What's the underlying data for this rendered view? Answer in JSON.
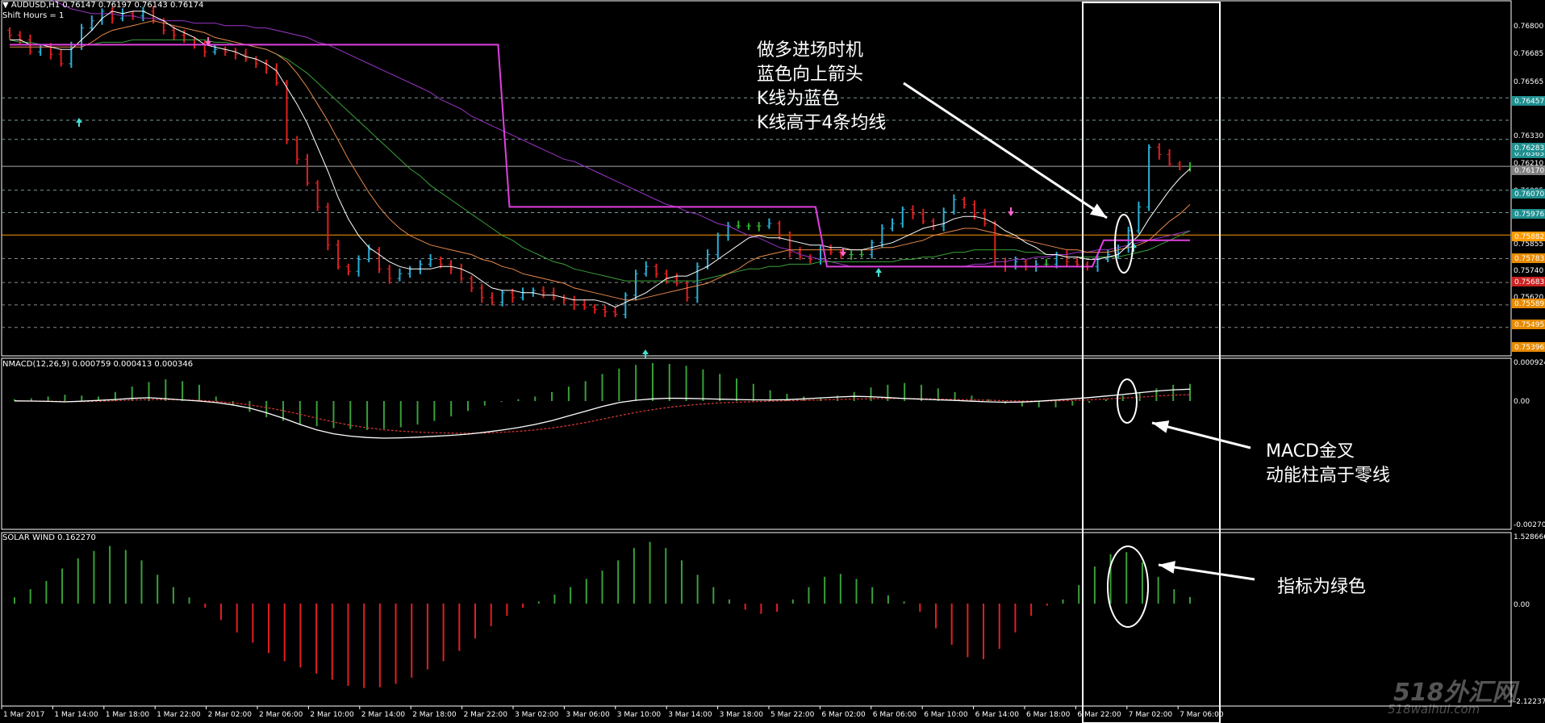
{
  "header": {
    "symbol": "AUDUSD,H1",
    "ohlc": "0.76147 0.76197 0.76143 0.76174",
    "shift": "Shift Hours = 1"
  },
  "macd": {
    "label": "NMACD(12,26,9) 0.000759 0.000413 0.000346",
    "scale": [
      "0.000924",
      "0.00",
      "-0.002707"
    ]
  },
  "solar": {
    "label": "SOLAR WIND 0.162270",
    "scale": [
      "1.528666",
      "0.00",
      "-2.122370"
    ]
  },
  "price_scale": {
    "labels": [
      "0.76800",
      "0.76685",
      "0.76565",
      "0.76330",
      "0.76210",
      "0.76095",
      "0.75855",
      "0.75740",
      "0.75620",
      "0.75505",
      "0.75396"
    ],
    "tags": [
      {
        "text": "0.76457",
        "color": "#1f8f8f"
      },
      {
        "text": "0.76363",
        "color": "#1f8f8f"
      },
      {
        "text": "0.76283",
        "color": "#1f8f8f"
      },
      {
        "text": "0.76170",
        "color": "#808080"
      },
      {
        "text": "0.76070",
        "color": "#1f8f8f"
      },
      {
        "text": "0.75976",
        "color": "#1f8f8f"
      },
      {
        "text": "0.75882",
        "color": "#ff9900"
      },
      {
        "text": "0.75783",
        "color": "#e68a00"
      },
      {
        "text": "0.75683",
        "color": "#cc2222"
      },
      {
        "text": "0.75589",
        "color": "#e68a00"
      },
      {
        "text": "0.75495",
        "color": "#e68a00"
      },
      {
        "text": "0.75396",
        "color": "#e68a00"
      }
    ]
  },
  "time_axis": [
    "1 Mar 2017",
    "1 Mar 14:00",
    "1 Mar 18:00",
    "1 Mar 22:00",
    "2 Mar 02:00",
    "2 Mar 06:00",
    "2 Mar 10:00",
    "2 Mar 14:00",
    "2 Mar 18:00",
    "2 Mar 22:00",
    "3 Mar 02:00",
    "3 Mar 06:00",
    "3 Mar 10:00",
    "3 Mar 14:00",
    "3 Mar 18:00",
    "5 Mar 22:00",
    "6 Mar 02:00",
    "6 Mar 06:00",
    "6 Mar 10:00",
    "6 Mar 14:00",
    "6 Mar 18:00",
    "6 Mar 22:00",
    "7 Mar 02:00",
    "7 Mar 06:00"
  ],
  "annotations": {
    "entry": [
      "做多进场时机",
      "蓝色向上箭头",
      "K线为蓝色",
      "K线高于4条均线"
    ],
    "macd": [
      "MACD金叉",
      "动能柱高于零线"
    ],
    "solar": [
      "指标为绿色"
    ]
  },
  "watermark": {
    "brand": "518外汇网",
    "url": "518waihui.com"
  },
  "colors": {
    "bull": "#2ab0d8",
    "bear": "#e02020",
    "neutral": "#30b030",
    "ma_white": "#ffffff",
    "ma_orange": "#e8894a",
    "ma_green": "#3aa03a",
    "ma_purple": "#9b35c8",
    "step": "#e040e0",
    "hist_pos": "#3aa03a",
    "hist_neg": "#e02020",
    "signal": "#cc3333",
    "grid": "#7a9a9a"
  },
  "chart_data": [
    {
      "type": "candlestick",
      "series": [
        {
          "name": "AUDUSD,H1"
        }
      ],
      "close": [
        0.7672,
        0.767,
        0.7665,
        0.7667,
        0.7664,
        0.766,
        0.7668,
        0.7675,
        0.7678,
        0.7682,
        0.7679,
        0.7681,
        0.768,
        0.7682,
        0.7678,
        0.7674,
        0.7672,
        0.767,
        0.7668,
        0.7665,
        0.7666,
        0.7665,
        0.7664,
        0.7662,
        0.766,
        0.7658,
        0.7652,
        0.7628,
        0.762,
        0.761,
        0.76,
        0.7584,
        0.7575,
        0.7573,
        0.7578,
        0.7582,
        0.7574,
        0.757,
        0.7572,
        0.7574,
        0.7576,
        0.7578,
        0.7576,
        0.7574,
        0.757,
        0.7566,
        0.7562,
        0.756,
        0.7564,
        0.7562,
        0.7564,
        0.7565,
        0.7564,
        0.7562,
        0.7561,
        0.7559,
        0.7558,
        0.7557,
        0.7556,
        0.7555,
        0.7563,
        0.7572,
        0.7575,
        0.7572,
        0.757,
        0.7568,
        0.7562,
        0.7575,
        0.758,
        0.7588,
        0.7592,
        0.7592,
        0.7592,
        0.7592,
        0.7593,
        0.7588,
        0.7581,
        0.7579,
        0.7578,
        0.7582,
        0.7581,
        0.758,
        0.758,
        0.758,
        0.7585,
        0.7591,
        0.7593,
        0.7599,
        0.7597,
        0.7594,
        0.7592,
        0.7598,
        0.7603,
        0.7601,
        0.7597,
        0.7593,
        0.7577,
        0.7575,
        0.7577,
        0.7575,
        0.7576,
        0.7576,
        0.758,
        0.7577,
        0.7576,
        0.7575,
        0.7578,
        0.758,
        0.7583,
        0.759,
        0.76,
        0.7625,
        0.7622,
        0.7618,
        0.7617,
        0.7617
      ],
      "ma_white": [
        0.767,
        0.767,
        0.7668,
        0.7668,
        0.7667,
        0.7666,
        0.7666,
        0.767,
        0.7674,
        0.7679,
        0.7682,
        0.7681,
        0.7682,
        0.7682,
        0.768,
        0.7678,
        0.7675,
        0.7673,
        0.7671,
        0.7668,
        0.7667,
        0.7666,
        0.7665,
        0.7663,
        0.7662,
        0.766,
        0.7657,
        0.765,
        0.7643,
        0.7635,
        0.7625,
        0.7615,
        0.7604,
        0.7595,
        0.7588,
        0.7583,
        0.758,
        0.7577,
        0.7575,
        0.7574,
        0.7574,
        0.7574,
        0.7575,
        0.7575,
        0.7574,
        0.7572,
        0.7569,
        0.7566,
        0.7565,
        0.7565,
        0.7564,
        0.7564,
        0.7563,
        0.7563,
        0.7562,
        0.7561,
        0.7561,
        0.7561,
        0.756,
        0.7558,
        0.756,
        0.7562,
        0.7564,
        0.7567,
        0.757,
        0.7571,
        0.7571,
        0.7573,
        0.7575,
        0.7578,
        0.7581,
        0.7584,
        0.7587,
        0.7588,
        0.7587,
        0.7587,
        0.7586,
        0.7585,
        0.7584,
        0.7584,
        0.7583,
        0.7583,
        0.7582,
        0.7582,
        0.7583,
        0.7584,
        0.7585,
        0.7587,
        0.7589,
        0.7591,
        0.7592,
        0.7593,
        0.7595,
        0.7596,
        0.7596,
        0.7595,
        0.7593,
        0.759,
        0.7588,
        0.7585,
        0.7583,
        0.758,
        0.758,
        0.7579,
        0.7579,
        0.7578,
        0.7578,
        0.7579,
        0.758,
        0.7584,
        0.7588,
        0.7595,
        0.7601,
        0.7607,
        0.7612,
        0.7616
      ],
      "ma_orange": [
        0.7667,
        0.7667,
        0.7667,
        0.7667,
        0.7667,
        0.7667,
        0.7667,
        0.7667,
        0.7669,
        0.7672,
        0.7674,
        0.7675,
        0.7676,
        0.7677,
        0.7678,
        0.7677,
        0.7676,
        0.7675,
        0.7674,
        0.7673,
        0.7671,
        0.767,
        0.7669,
        0.7668,
        0.7667,
        0.7666,
        0.7664,
        0.7661,
        0.7656,
        0.765,
        0.7643,
        0.7636,
        0.7628,
        0.762,
        0.7613,
        0.7606,
        0.76,
        0.7595,
        0.7591,
        0.7588,
        0.7586,
        0.7584,
        0.7583,
        0.7582,
        0.7581,
        0.758,
        0.7578,
        0.7577,
        0.7575,
        0.7574,
        0.7572,
        0.7571,
        0.757,
        0.7569,
        0.7568,
        0.7566,
        0.7565,
        0.7564,
        0.7563,
        0.7562,
        0.7561,
        0.7561,
        0.7562,
        0.7563,
        0.7564,
        0.7565,
        0.7566,
        0.7567,
        0.7568,
        0.757,
        0.7572,
        0.7574,
        0.7577,
        0.7579,
        0.758,
        0.7581,
        0.7582,
        0.7582,
        0.7582,
        0.7582,
        0.7582,
        0.7582,
        0.7582,
        0.7582,
        0.7582,
        0.7583,
        0.7583,
        0.7584,
        0.7585,
        0.7586,
        0.7588,
        0.7589,
        0.759,
        0.7591,
        0.7591,
        0.759,
        0.7589,
        0.7588,
        0.7587,
        0.7586,
        0.7585,
        0.7584,
        0.7583,
        0.7582,
        0.7582,
        0.7581,
        0.7581,
        0.7581,
        0.7582,
        0.7583,
        0.7584,
        0.7586,
        0.759,
        0.7594,
        0.7597,
        0.7601
      ],
      "ma_green": [
        0.767,
        0.7669,
        0.7669,
        0.7668,
        0.7668,
        0.7668,
        0.7668,
        0.7668,
        0.7668,
        0.7669,
        0.7669,
        0.7669,
        0.767,
        0.767,
        0.767,
        0.767,
        0.767,
        0.767,
        0.767,
        0.767,
        0.7669,
        0.7669,
        0.7668,
        0.7668,
        0.7667,
        0.7666,
        0.7664,
        0.7662,
        0.7659,
        0.7656,
        0.7652,
        0.7648,
        0.7644,
        0.764,
        0.7636,
        0.7632,
        0.7628,
        0.7624,
        0.762,
        0.7616,
        0.7613,
        0.7609,
        0.7606,
        0.7603,
        0.76,
        0.7597,
        0.7594,
        0.7591,
        0.7588,
        0.7586,
        0.7583,
        0.7581,
        0.7579,
        0.7577,
        0.7576,
        0.7574,
        0.7573,
        0.7572,
        0.7571,
        0.757,
        0.7569,
        0.7569,
        0.7569,
        0.7569,
        0.7569,
        0.7569,
        0.7569,
        0.7569,
        0.757,
        0.7571,
        0.7572,
        0.7573,
        0.7574,
        0.7574,
        0.7575,
        0.7575,
        0.7576,
        0.7576,
        0.7576,
        0.7577,
        0.7577,
        0.7577,
        0.7577,
        0.7577,
        0.7577,
        0.7577,
        0.7577,
        0.7578,
        0.7578,
        0.7579,
        0.7579,
        0.758,
        0.7581,
        0.7581,
        0.7582,
        0.7582,
        0.7582,
        0.7582,
        0.7582,
        0.7581,
        0.7581,
        0.758,
        0.758,
        0.7579,
        0.7579,
        0.7579,
        0.7579,
        0.7579,
        0.7579,
        0.758,
        0.7581,
        0.7582,
        0.7584,
        0.7586,
        0.7588,
        0.759
      ],
      "ma_purple": [
        0.7698,
        0.7695,
        0.7692,
        0.769,
        0.7687,
        0.7685,
        0.7683,
        0.7682,
        0.7681,
        0.7681,
        0.7681,
        0.768,
        0.768,
        0.7679,
        0.7679,
        0.7678,
        0.7678,
        0.7678,
        0.7677,
        0.7677,
        0.7677,
        0.7676,
        0.7676,
        0.7676,
        0.7675,
        0.7675,
        0.7674,
        0.7673,
        0.7672,
        0.7671,
        0.7669,
        0.7668,
        0.7666,
        0.7664,
        0.7662,
        0.766,
        0.7658,
        0.7656,
        0.7654,
        0.7652,
        0.765,
        0.7648,
        0.7645,
        0.7643,
        0.7641,
        0.7638,
        0.7636,
        0.7634,
        0.7632,
        0.763,
        0.7628,
        0.7626,
        0.7624,
        0.7622,
        0.762,
        0.7619,
        0.7617,
        0.7615,
        0.7613,
        0.7611,
        0.7609,
        0.7607,
        0.7605,
        0.7603,
        0.7601,
        0.76,
        0.7598,
        0.7597,
        0.7595,
        0.7593,
        0.7592,
        0.759,
        0.7588,
        0.7587,
        0.7585,
        0.7583,
        0.7582,
        0.758,
        0.7579,
        0.7578,
        0.7577,
        0.7576,
        0.7575,
        0.7575,
        0.7575,
        0.7575,
        0.7575,
        0.7575,
        0.7575,
        0.7575,
        0.7575,
        0.7575,
        0.7575,
        0.7575,
        0.7576,
        0.7576,
        0.7577,
        0.7577,
        0.7578,
        0.7578,
        0.7579,
        0.7579,
        0.758,
        0.758,
        0.7581,
        0.7581,
        0.7582,
        0.7582,
        0.7583,
        0.7584,
        0.7585,
        0.7586,
        0.7587,
        0.7588,
        0.7589,
        0.759
      ],
      "step_levels": [
        {
          "from": 0,
          "to": 60,
          "value": 0.7668
        },
        {
          "from": 61,
          "to": 99,
          "value": 0.76
        },
        {
          "from": 100,
          "to": 133,
          "value": 0.7575
        },
        {
          "from": 134,
          "to": 145,
          "value": 0.7586
        }
      ],
      "horizontal_lines": [
        0.76457,
        0.76363,
        0.76283,
        0.7617,
        0.7607,
        0.75976,
        0.75882,
        0.75783,
        0.75683,
        0.75589,
        0.75495
      ]
    },
    {
      "type": "bar",
      "title": "NMACD(12,26,9) 0.000759 0.000413 0.000346",
      "ylim": [
        -0.002707,
        0.000924
      ],
      "series": [
        {
          "name": "histogram",
          "values": [
            2e-05,
            3e-05,
            5e-05,
            7e-05,
            6e-05,
            5e-05,
            0.0001,
            0.00016,
            0.00021,
            0.00024,
            0.00022,
            0.00018,
            5e-05,
            -5e-05,
            -0.00012,
            -0.00018,
            -0.00022,
            -0.00026,
            -0.00028,
            -0.0003,
            -0.00031,
            -0.00032,
            -0.00031,
            -0.00029,
            -0.00026,
            -0.00022,
            -0.00017,
            -0.00011,
            -5e-05,
            -1e-05,
            2e-05,
            5e-05,
            0.0001,
            0.00016,
            0.00022,
            0.0003,
            0.00036,
            0.0004,
            0.00042,
            0.00041,
            0.00039,
            0.00035,
            0.0003,
            0.00025,
            0.00019,
            0.00012,
            8e-05,
            5e-05,
            4e-05,
            6e-05,
            0.0001,
            0.00015,
            0.00018,
            0.0002,
            0.00018,
            0.00014,
            0.0001,
            6e-05,
            2e-05,
            -3e-05,
            -6e-05,
            -7e-05,
            -7e-05,
            -5e-05,
            -2e-05,
            2e-05,
            6e-05,
            0.0001,
            0.00014,
            0.00018,
            0.00019
          ]
        },
        {
          "name": "NMACD",
          "values": [
            1e-05,
            0.0,
            -2e-05,
            -5e-05,
            -1e-05,
            4e-05,
            0.0001,
            0.00017,
            0.00021,
            0.00015,
            7e-05,
            0.0,
            -0.0001,
            -0.00025,
            -0.00045,
            -0.00075,
            -0.0011,
            -0.0015,
            -0.00185,
            -0.0021,
            -0.00225,
            -0.00234,
            -0.00238,
            -0.00236,
            -0.00232,
            -0.00226,
            -0.0022,
            -0.00212,
            -0.002,
            -0.00186,
            -0.0017,
            -0.0015,
            -0.00125,
            -0.00095,
            -0.00065,
            -0.00035,
            -0.0001,
            5e-05,
            0.00014,
            0.00018,
            0.00017,
            0.00015,
            0.00012,
            0.0001,
            8e-05,
            7e-05,
            9e-05,
            0.00014,
            0.0002,
            0.00026,
            0.0003,
            0.00028,
            0.00022,
            0.00016,
            0.00012,
            8e-05,
            4e-05,
            -1e-05,
            -5e-05,
            -8e-05,
            -6e-05,
            -1e-05,
            6e-05,
            0.00014,
            0.00022,
            0.00032,
            0.00042,
            0.00054,
            0.00064,
            0.00072,
            0.00076
          ]
        },
        {
          "name": "Signal",
          "values": [
            0.0,
            0.0,
            -1e-05,
            -3e-05,
            -3e-05,
            -1e-05,
            2e-05,
            6e-05,
            9e-05,
            0.0001,
            8e-05,
            4e-05,
            -3e-05,
            -0.00012,
            -0.00025,
            -0.00042,
            -0.00062,
            -0.00085,
            -0.0011,
            -0.00134,
            -0.00155,
            -0.00172,
            -0.00184,
            -0.00193,
            -0.00199,
            -0.00203,
            -0.00206,
            -0.00207,
            -0.00205,
            -0.002,
            -0.00194,
            -0.00185,
            -0.00173,
            -0.00157,
            -0.00138,
            -0.00116,
            -0.00094,
            -0.00073,
            -0.00055,
            -0.0004,
            -0.00028,
            -0.00019,
            -0.00012,
            -8e-05,
            -4e-05,
            -1e-05,
            2e-05,
            4e-05,
            7e-05,
            0.0001,
            0.00013,
            0.00015,
            0.00016,
            0.00016,
            0.00015,
            0.00013,
            0.0001,
            8e-05,
            5e-05,
            2e-05,
            0.0,
            0.0,
            1e-05,
            4e-05,
            8e-05,
            0.00013,
            0.00019,
            0.00025,
            0.00032,
            0.00038,
            0.00041
          ]
        }
      ]
    },
    {
      "type": "bar",
      "title": "SOLAR WIND 0.162270",
      "ylim": [
        -2.12237,
        1.528666
      ],
      "series": [
        {
          "name": "SOLAR WIND",
          "values": [
            0.15,
            0.35,
            0.55,
            0.85,
            1.1,
            1.28,
            1.4,
            1.3,
            1.05,
            0.7,
            0.4,
            0.15,
            -0.1,
            -0.4,
            -0.7,
            -0.95,
            -1.2,
            -1.4,
            -1.55,
            -1.7,
            -1.85,
            -2.0,
            -2.05,
            -2.03,
            -1.95,
            -1.8,
            -1.6,
            -1.4,
            -1.15,
            -0.85,
            -0.55,
            -0.3,
            -0.1,
            0.05,
            0.22,
            0.4,
            0.6,
            0.8,
            1.05,
            1.35,
            1.5,
            1.35,
            1.05,
            0.7,
            0.4,
            0.1,
            -0.15,
            -0.25,
            -0.2,
            0.1,
            0.4,
            0.65,
            0.72,
            0.6,
            0.4,
            0.2,
            0.05,
            -0.2,
            -0.6,
            -1.0,
            -1.3,
            -1.35,
            -1.1,
            -0.7,
            -0.3,
            -0.05,
            0.1,
            0.45,
            0.9,
            1.2,
            1.25,
            1.0,
            0.65,
            0.35,
            0.16
          ]
        }
      ]
    }
  ]
}
